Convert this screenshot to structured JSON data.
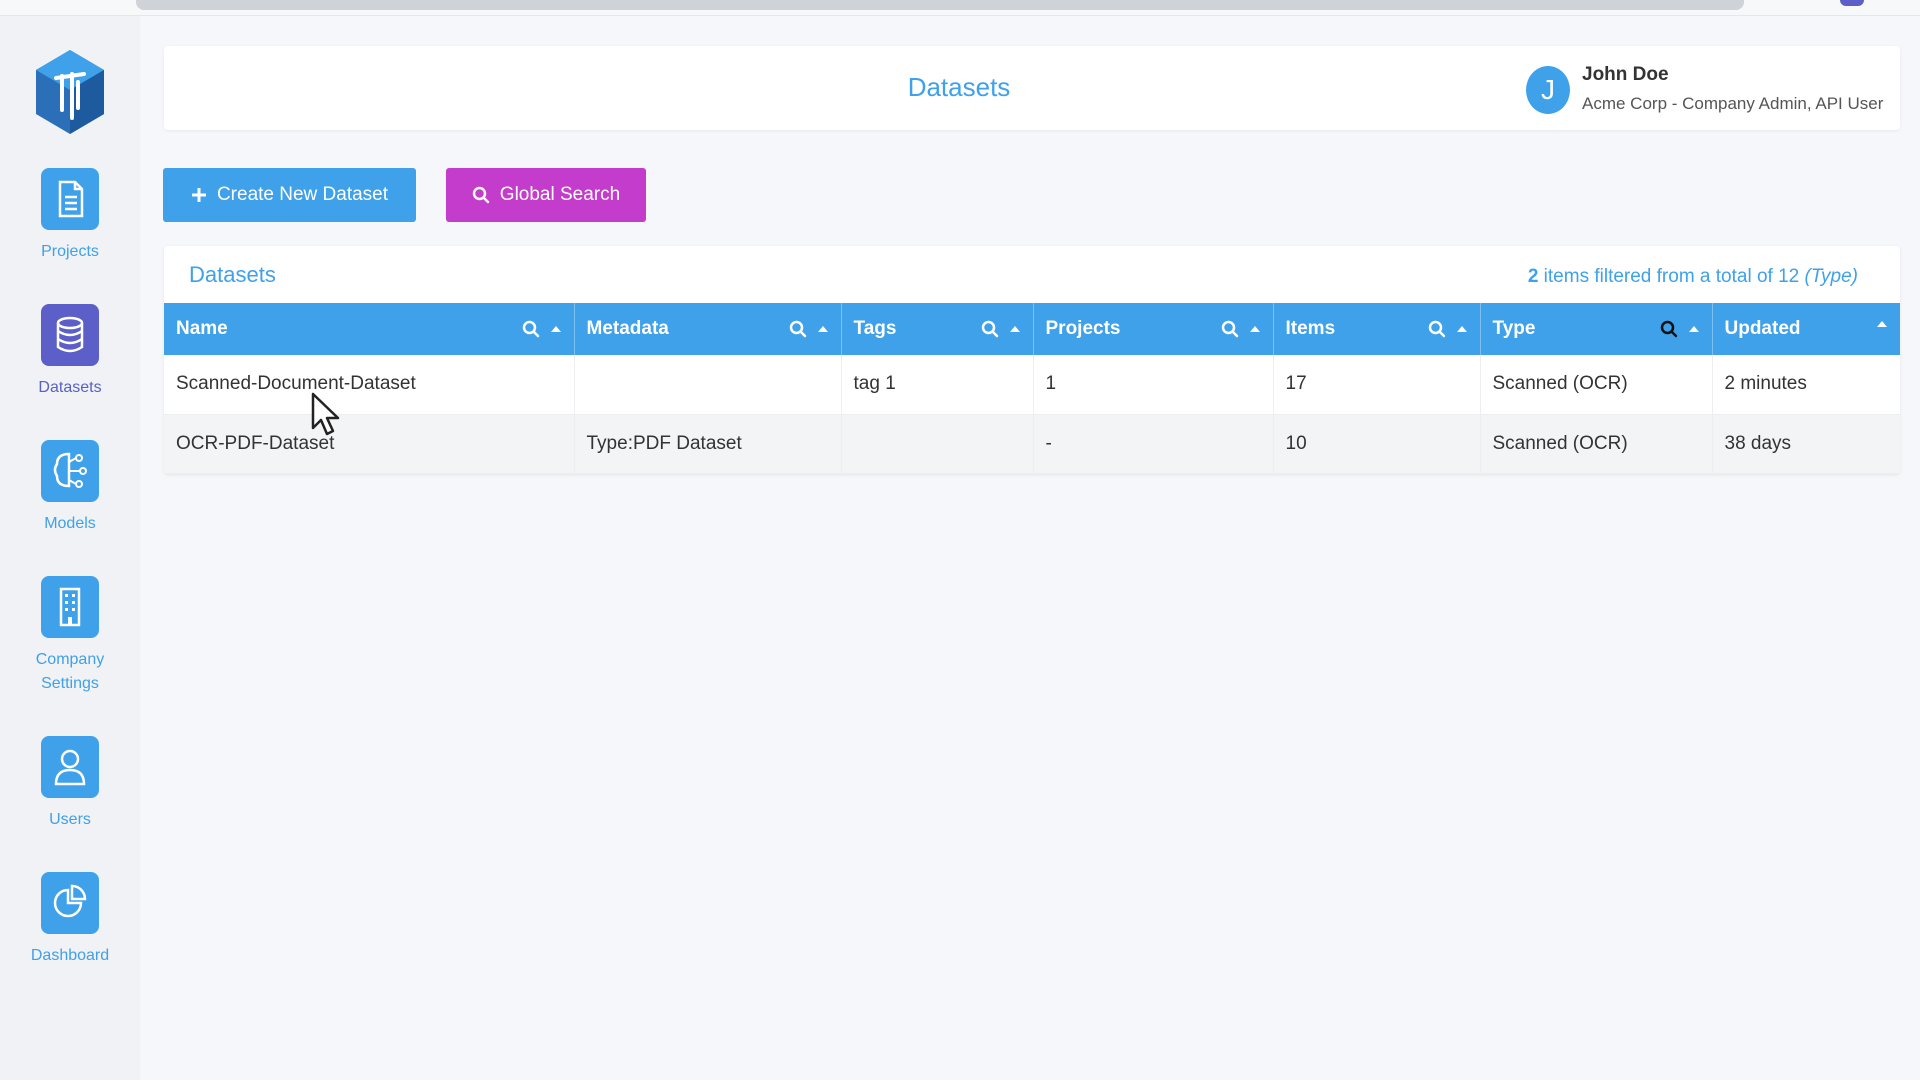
{
  "header": {
    "title": "Datasets",
    "user": {
      "initial": "J",
      "name": "John Doe",
      "role": "Acme Corp - Company Admin, API User"
    }
  },
  "sidebar": {
    "items": [
      {
        "label": "Projects",
        "icon": "document-icon"
      },
      {
        "label": "Datasets",
        "icon": "database-icon",
        "active": true
      },
      {
        "label": "Models",
        "icon": "brain-icon"
      },
      {
        "label": "Company",
        "label2": "Settings",
        "icon": "building-icon"
      },
      {
        "label": "Users",
        "icon": "user-icon"
      },
      {
        "label": "Dashboard",
        "icon": "pie-chart-icon"
      }
    ]
  },
  "toolbar": {
    "create_label": "Create New Dataset",
    "search_label": "Global Search"
  },
  "panel": {
    "title": "Datasets",
    "filter": {
      "count": "2",
      "text": " items filtered from a total of 12 ",
      "note": "(Type)"
    }
  },
  "table": {
    "columns": [
      "Name",
      "Metadata",
      "Tags",
      "Projects",
      "Items",
      "Type",
      "Updated"
    ],
    "rows": [
      [
        "Scanned-Document-Dataset",
        "",
        "tag 1",
        "1",
        "17",
        "Scanned (OCR)",
        "2 minutes"
      ],
      [
        "OCR-PDF-Dataset",
        "Type:PDF Dataset",
        "",
        "-",
        "10",
        "Scanned (OCR)",
        "38 days"
      ]
    ]
  },
  "colors": {
    "primary": "#3ea1ea",
    "active": "#5b5fc7",
    "search_button": "#c43ccb"
  }
}
